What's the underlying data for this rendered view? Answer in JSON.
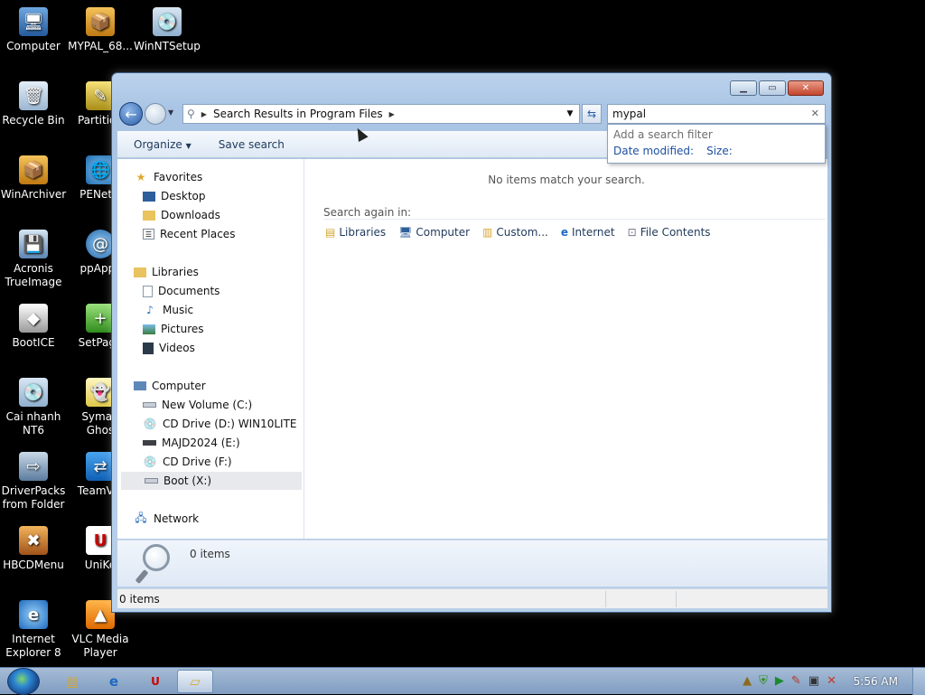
{
  "desktop": {
    "icons": [
      {
        "label": "Computer",
        "icon": "computer-icon"
      },
      {
        "label": "MYPAL_68...",
        "icon": "package-icon"
      },
      {
        "label": "WinNTSetup",
        "icon": "setup-icon"
      },
      {
        "label": "Recycle Bin",
        "icon": "recycle-bin-icon"
      },
      {
        "label": "Partition",
        "icon": "partition-icon"
      },
      {
        "label": "WinArchiver",
        "icon": "archive-icon"
      },
      {
        "label": "PENetw",
        "icon": "network-globe-icon"
      },
      {
        "label": "Acronis\nTrueImage",
        "icon": "acronis-icon"
      },
      {
        "label": "ppApps",
        "icon": "swirl-icon"
      },
      {
        "label": "BootICE",
        "icon": "bootice-icon"
      },
      {
        "label": "SetPage",
        "icon": "setpage-icon"
      },
      {
        "label": "Cai nhanh\nNT6",
        "icon": "install-icon"
      },
      {
        "label": "Syman\nGhos",
        "icon": "ghost-icon"
      },
      {
        "label": "DriverPacks\nfrom Folder",
        "icon": "driverpack-icon"
      },
      {
        "label": "TeamVie",
        "icon": "teamviewer-icon"
      },
      {
        "label": "HBCDMenu",
        "icon": "tools-icon"
      },
      {
        "label": "UniKe",
        "icon": "unikey-icon"
      },
      {
        "label": "Internet\nExplorer 8",
        "icon": "ie-icon"
      },
      {
        "label": "VLC Media\nPlayer",
        "icon": "vlc-icon"
      }
    ]
  },
  "window": {
    "address": {
      "segment": "Search Results in Program Files"
    },
    "search": {
      "value": "mypal"
    },
    "suggestions": {
      "hint": "Add a search filter",
      "filters": [
        "Date modified:",
        "Size:"
      ]
    },
    "toolbar": {
      "organize": "Organize",
      "save_search": "Save search"
    },
    "nav": {
      "favorites": "Favorites",
      "fav_items": [
        "Desktop",
        "Downloads",
        "Recent Places"
      ],
      "libraries": "Libraries",
      "lib_items": [
        "Documents",
        "Music",
        "Pictures",
        "Videos"
      ],
      "computer": "Computer",
      "drives": [
        "New Volume (C:)",
        "CD Drive (D:) WIN10LITE",
        "MAJD2024 (E:)",
        "CD Drive (F:)",
        "Boot (X:)"
      ],
      "network": "Network"
    },
    "results": {
      "empty_message": "No items match your search.",
      "search_again_label": "Search again in:",
      "search_again_items": [
        "Libraries",
        "Computer",
        "Custom...",
        "Internet",
        "File Contents"
      ]
    },
    "details": {
      "count": "0 items"
    },
    "status": {
      "count": "0 items"
    }
  },
  "taskbar": {
    "clock": "5:56 AM"
  }
}
